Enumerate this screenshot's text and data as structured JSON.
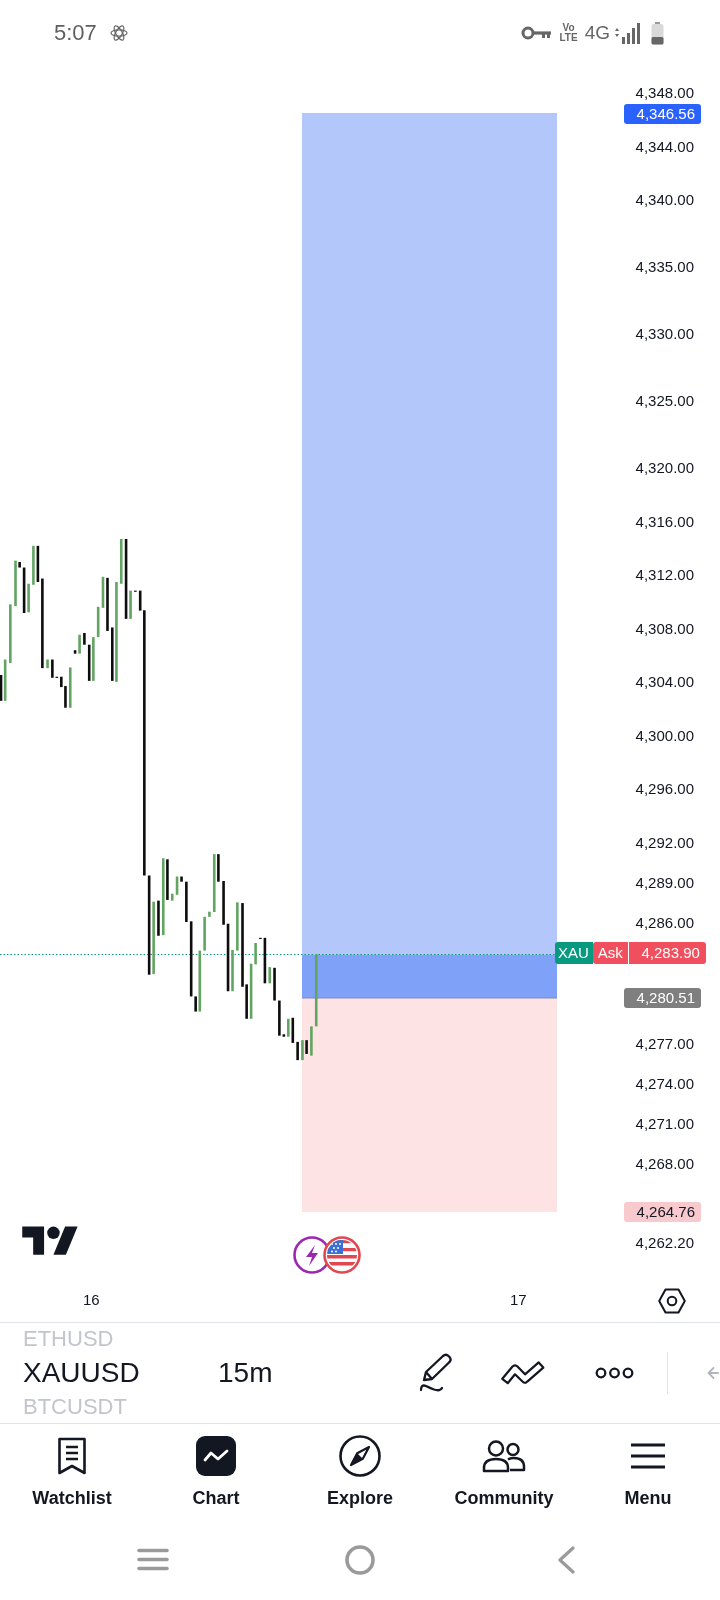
{
  "status_bar": {
    "time": "5:07",
    "volte": {
      "top": "Vo",
      "bottom": "LTE"
    },
    "network": "4G"
  },
  "chart": {
    "price_axis": [
      "4,348.00",
      "4,344.00",
      "4,340.00",
      "4,335.00",
      "4,330.00",
      "4,325.00",
      "4,320.00",
      "4,316.00",
      "4,312.00",
      "4,308.00",
      "4,304.00",
      "4,300.00",
      "4,296.00",
      "4,292.00",
      "4,289.00",
      "4,286.00",
      "4,277.00",
      "4,274.00",
      "4,271.00",
      "4,268.00",
      "4,262.20"
    ],
    "price_tags": [
      {
        "kind": "target",
        "text": "4,346.56"
      },
      {
        "kind": "entry",
        "text": "4,280.51"
      },
      {
        "kind": "stop",
        "text": "4,264.76"
      }
    ],
    "quote_tag": {
      "symbol": "XAU",
      "side": "Ask",
      "price": "4,283.90"
    },
    "time_axis": [
      "16",
      "17"
    ]
  },
  "symbol_bar": {
    "symbols": [
      {
        "text": "ETHUSD",
        "selected": false
      },
      {
        "text": "XAUUSD",
        "selected": true
      },
      {
        "text": "BTCUSDT",
        "selected": false
      }
    ],
    "interval": "15m"
  },
  "bottom_nav": [
    {
      "kind": "watchlist",
      "label": "Watchlist",
      "selected": false
    },
    {
      "kind": "chart",
      "label": "Chart",
      "selected": true
    },
    {
      "kind": "explore",
      "label": "Explore",
      "selected": false
    },
    {
      "kind": "community",
      "label": "Community",
      "selected": false
    },
    {
      "kind": "menu",
      "label": "Menu",
      "selected": false
    }
  ]
}
